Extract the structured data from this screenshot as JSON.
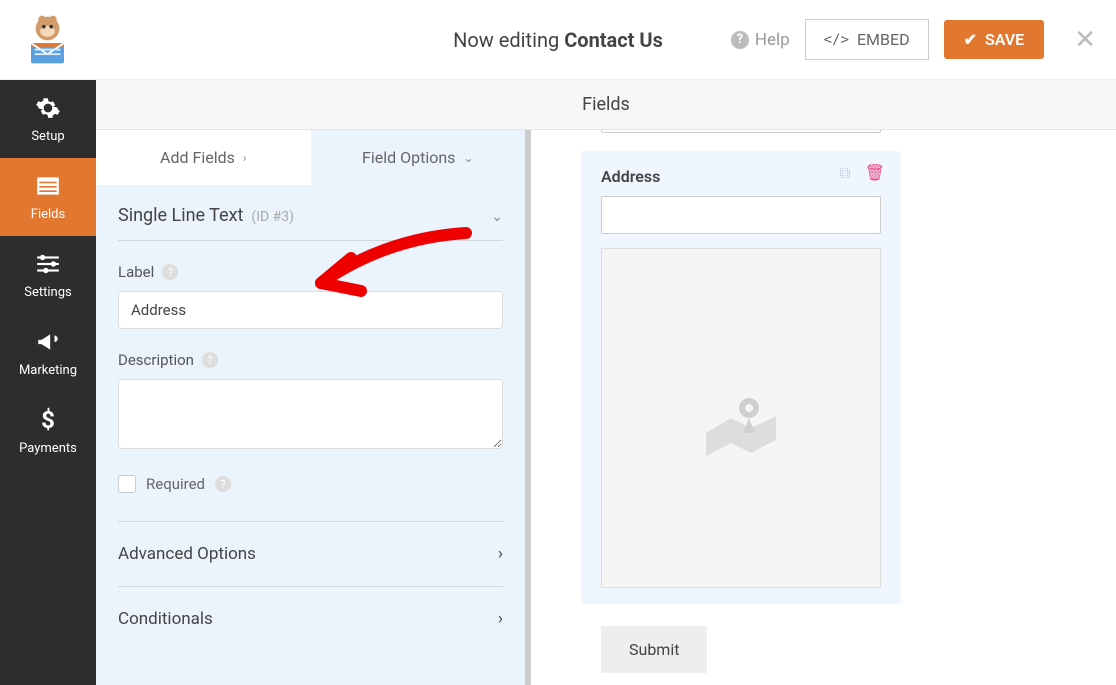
{
  "header": {
    "editing_prefix": "Now editing ",
    "editing_title": "Contact Us",
    "help": "Help",
    "embed": "EMBED",
    "save": "SAVE"
  },
  "subheader": "Fields",
  "sidebar": {
    "items": [
      {
        "label": "Setup"
      },
      {
        "label": "Fields"
      },
      {
        "label": "Settings"
      },
      {
        "label": "Marketing"
      },
      {
        "label": "Payments"
      }
    ]
  },
  "panel": {
    "tabs": {
      "add": "Add Fields",
      "options": "Field Options"
    },
    "field_type": "Single Line Text",
    "field_id": "(ID #3)",
    "label_label": "Label",
    "label_value": "Address",
    "desc_label": "Description",
    "desc_value": "",
    "required_label": "Required",
    "sections": {
      "advanced": "Advanced Options",
      "conditionals": "Conditionals"
    }
  },
  "preview": {
    "address_label": "Address",
    "submit": "Submit"
  }
}
